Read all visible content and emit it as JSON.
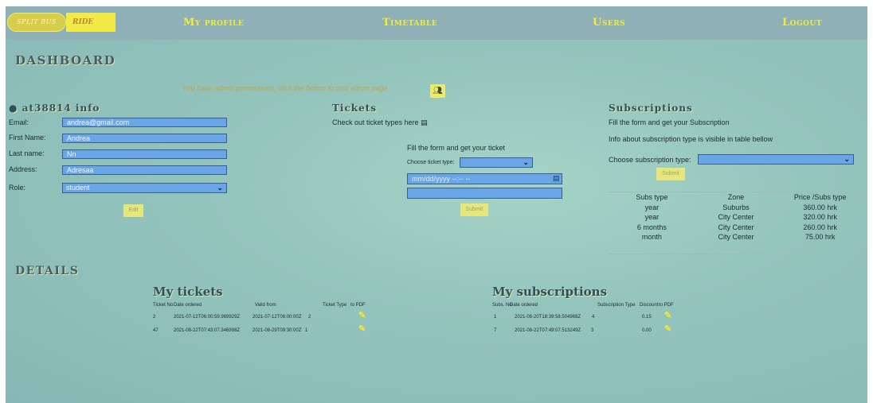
{
  "nav": {
    "logo_left": "SPLIT BUS",
    "logo_right": "RIDE",
    "my_profile": "My profile",
    "timetable": "Timetable",
    "users": "Users",
    "logout": "Logout"
  },
  "dashboard": {
    "title": "DASHBOARD",
    "admin_text": "You have admin permissions, click the button to visit admin page",
    "admin_icon": "users-icon"
  },
  "info": {
    "title": "at38814 info",
    "email_label": "Email:",
    "email_value": "andrea@gmail.com",
    "first_name_label": "First Name:",
    "first_name_value": "Andrea",
    "last_name_label": "Last name:",
    "last_name_value": "Nn",
    "address_label": "Address:",
    "address_value": "Adresaa",
    "role_label": "Role:",
    "role_value": "student",
    "edit_label": "Edit"
  },
  "tickets": {
    "title": "Tickets",
    "check_text": "Check out ticket types here",
    "form_title": "Fill the form and get your ticket",
    "type_label": "Choose ticket type:",
    "date_placeholder": "mm/dd/yyyy --:-- --",
    "submit_label": "Submit"
  },
  "subscriptions": {
    "title": "Subscriptions",
    "line1": "Fill the form and get your Subscription",
    "line2": "Info about subscription type is visible in table bellow",
    "type_label": "Choose subscription type:",
    "submit_label": "Submit",
    "table": {
      "headers": [
        "Subs type",
        "Zone",
        "Price /Subs type"
      ],
      "rows": [
        [
          "year",
          "Suburbs",
          "360.00 hrk"
        ],
        [
          "year",
          "City Center",
          "320.00 hrk"
        ],
        [
          "6 months",
          "City Center",
          "260.00 hrk"
        ],
        [
          "month",
          "City Center",
          "75.00 hrk"
        ]
      ]
    }
  },
  "details": {
    "title": "DETAILS",
    "my_tickets": {
      "title": "My tickets",
      "headers": [
        "Ticket No",
        "Date ordered",
        "Valid from",
        "Ticket Type",
        "to PDF"
      ],
      "rows": [
        [
          "2",
          "2021-07-12T06:00:59.969929Z",
          "2021-07-12T06:00:00Z",
          "2"
        ],
        [
          "47",
          "2021-08-22T07:43:07.346998Z",
          "2021-08-29T09:30:00Z",
          "1"
        ]
      ]
    },
    "my_subscriptions": {
      "title": "My subscriptions",
      "headers": [
        "Subs. No",
        "Date ordered",
        "Subscription Type",
        "Discount",
        "to PDF"
      ],
      "rows": [
        [
          "1",
          "2021-08-20T18:39:58.504968Z",
          "4",
          "0.15"
        ],
        [
          "7",
          "2021-08-22T07:49:07.513249Z",
          "3",
          "0.00"
        ]
      ]
    }
  }
}
